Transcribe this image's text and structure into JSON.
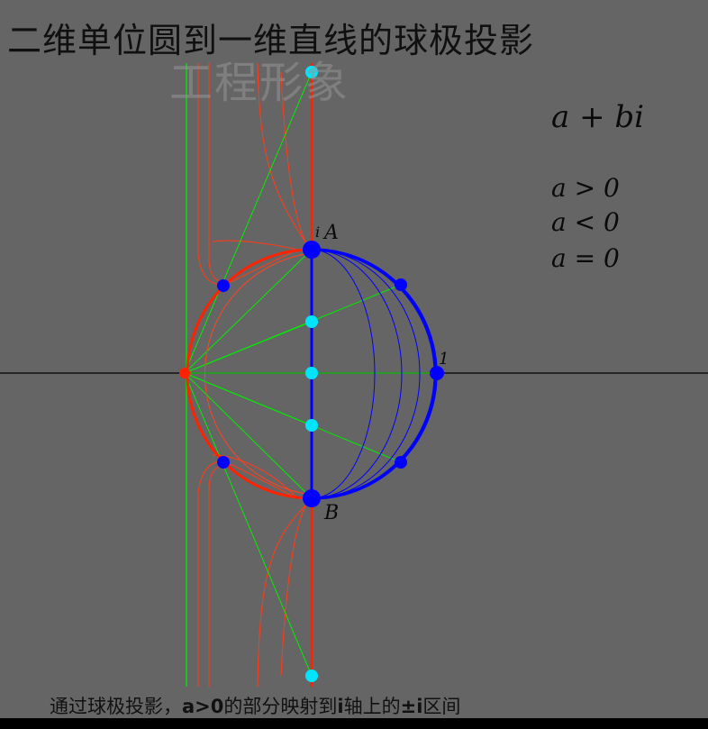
{
  "title": "二维单位圆到一维直线的球极投影",
  "watermark": "工程形象",
  "formula": "a + bi",
  "conditions": [
    "a > 0",
    "a < 0",
    "a = 0"
  ],
  "point_labels": {
    "i": "i",
    "A": "A",
    "B": "B",
    "one": "1"
  },
  "caption": {
    "part1": "通过球极投影，",
    "bold1": "a>0",
    "part2": "的部分映射到",
    "bold2": "i",
    "part3": "轴上的",
    "bold3": "±i",
    "part4": "区间"
  },
  "colors": {
    "background": "#656565",
    "blue": "#0000ff",
    "red": "#ff2200",
    "green": "#00ee00",
    "cyan": "#00e5ff"
  }
}
